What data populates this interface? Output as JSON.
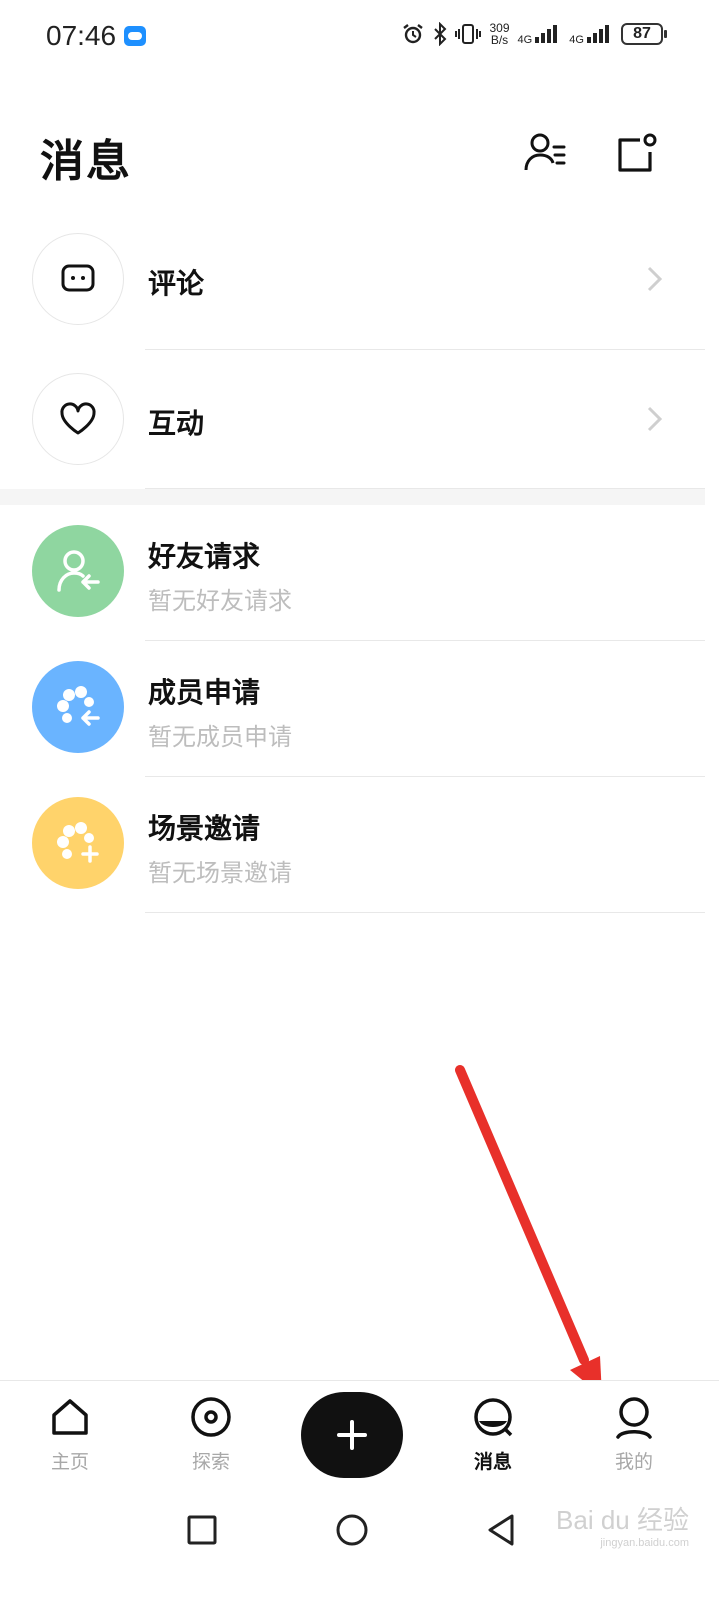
{
  "status_bar": {
    "time": "07:46",
    "net_speed_top": "309",
    "net_speed_bottom": "B/s",
    "signal1": "4G",
    "signal2": "4G",
    "battery": "87"
  },
  "header": {
    "title": "消息"
  },
  "top_items": [
    {
      "label": "评论",
      "icon": "comment-icon"
    },
    {
      "label": "互动",
      "icon": "heart-icon"
    }
  ],
  "requests": [
    {
      "label": "好友请求",
      "sub": "暂无好友请求",
      "color": "#8fd6a0",
      "icon": "friend-request-icon"
    },
    {
      "label": "成员申请",
      "sub": "暂无成员申请",
      "color": "#6ab4ff",
      "icon": "member-apply-icon"
    },
    {
      "label": "场景邀请",
      "sub": "暂无场景邀请",
      "color": "#ffd36b",
      "icon": "scene-invite-icon"
    }
  ],
  "tabs": [
    {
      "label": "主页",
      "icon": "home-icon",
      "active": false
    },
    {
      "label": "探索",
      "icon": "explore-icon",
      "active": false
    },
    {
      "label": "消息",
      "icon": "message-icon",
      "active": true
    },
    {
      "label": "我的",
      "icon": "profile-icon",
      "active": false
    }
  ],
  "watermark": {
    "text": "Bai du 经验",
    "sub": "jingyan.baidu.com"
  },
  "colors": {
    "accent_arrow": "#e8302a",
    "active": "#111111",
    "inactive": "#a8a8a8"
  }
}
